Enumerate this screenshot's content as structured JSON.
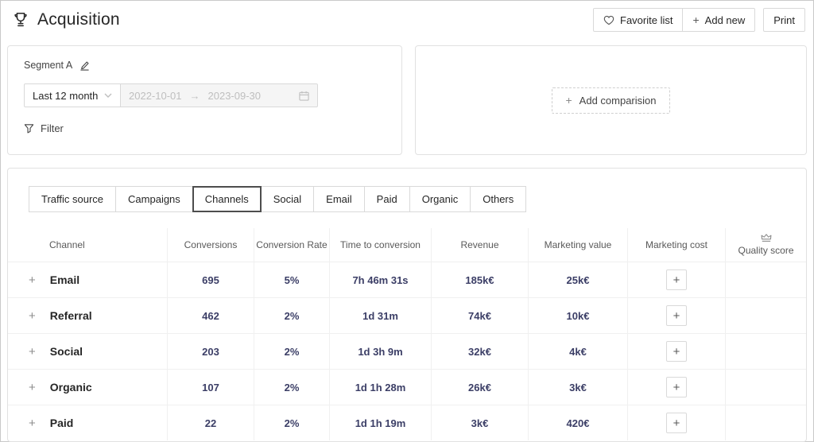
{
  "header": {
    "title": "Acquisition",
    "favorite_button": "Favorite list",
    "add_new_button": "Add new",
    "add_new_plus": "+",
    "print_button": "Print"
  },
  "segment": {
    "name": "Segment A",
    "period": "Last 12 month",
    "date_start": "2022-10-01",
    "date_arrow": "→",
    "date_end": "2023-09-30",
    "filter_label": "Filter"
  },
  "comparison": {
    "plus": "+",
    "add_label": "Add comparision"
  },
  "tabs": {
    "items": [
      "Traffic source",
      "Campaigns",
      "Channels",
      "Social",
      "Email",
      "Paid",
      "Organic",
      "Others"
    ],
    "active": "Channels"
  },
  "table": {
    "columns": [
      "Channel",
      "Conversions",
      "Conversion Rate",
      "Time to conversion",
      "Revenue",
      "Marketing value",
      "Marketing cost",
      "Quality score"
    ],
    "expand_glyph": "+",
    "cost_button_glyph": "+",
    "rows": [
      {
        "channel": "Email",
        "conversions": "695",
        "conversion_rate": "5%",
        "time_to_conversion": "7h 46m 31s",
        "revenue": "185k€",
        "marketing_value": "25k€"
      },
      {
        "channel": "Referral",
        "conversions": "462",
        "conversion_rate": "2%",
        "time_to_conversion": "1d 31m",
        "revenue": "74k€",
        "marketing_value": "10k€"
      },
      {
        "channel": "Social",
        "conversions": "203",
        "conversion_rate": "2%",
        "time_to_conversion": "1d 3h 9m",
        "revenue": "32k€",
        "marketing_value": "4k€"
      },
      {
        "channel": "Organic",
        "conversions": "107",
        "conversion_rate": "2%",
        "time_to_conversion": "1d 1h 28m",
        "revenue": "26k€",
        "marketing_value": "3k€"
      },
      {
        "channel": "Paid",
        "conversions": "22",
        "conversion_rate": "2%",
        "time_to_conversion": "1d 1h 19m",
        "revenue": "3k€",
        "marketing_value": "420€"
      }
    ]
  },
  "colors": {
    "accent_number": "#3b3e66",
    "panel_border": "#e1e1e1",
    "row_border": "#f0f0f0",
    "text_primary": "#262626",
    "text_secondary": "#595959"
  }
}
